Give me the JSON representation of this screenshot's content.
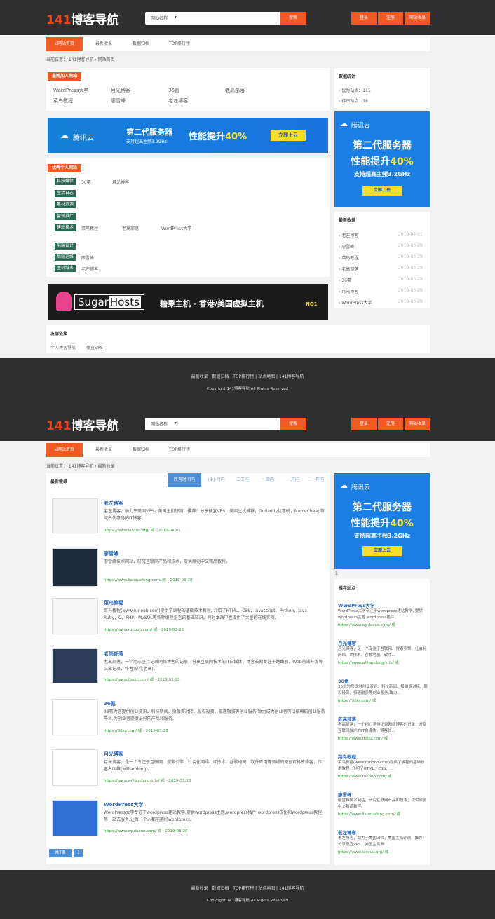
{
  "header": {
    "logo_num": "141",
    "logo_text": "博客导航",
    "search_select": "网站名称",
    "search_btn": "搜索",
    "btn_login": "登录",
    "btn_register": "注册",
    "btn_submit": "网站收录"
  },
  "nav": [
    "网站首页",
    "最新收录",
    "数据归档",
    "TOP排行榜"
  ],
  "page1": {
    "crumb": "当前位置： 141博客导航  ›  网站首页",
    "latest": {
      "title": "最新加入网站",
      "links": [
        "WordPress大学",
        "月光博客",
        "36氪",
        "老高部落",
        "菜鸟教程",
        "廖雪峰",
        "老左博客"
      ]
    },
    "stats": {
      "title": "数据统计",
      "lines": [
        "› 优秀站点：115",
        "› 待审站点：18"
      ]
    },
    "ad_banner": {
      "brand": "腾讯云",
      "l1": "第二代服务器",
      "l2": "支持超高主频3.2GHz",
      "l3": "性能提升",
      "pct": "40%",
      "btn": "立即上云"
    },
    "personal": {
      "title": "优秀个人网站",
      "rows": [
        {
          "tag": "科技媒体",
          "links": [
            "36氪",
            "月光博客"
          ]
        },
        {
          "tag": "生活日志",
          "links": []
        },
        {
          "tag": "素材资源",
          "links": []
        },
        {
          "tag": "营销推广",
          "links": []
        },
        {
          "tag": "建站技术",
          "links": [
            "菜鸟教程",
            "老高部落",
            "WordPress大学"
          ]
        },
        {
          "tag": "前端设计",
          "links": []
        },
        {
          "tag": "后端运维",
          "links": [
            "廖雪峰"
          ]
        },
        {
          "tag": "主机域名",
          "links": [
            "老左博客"
          ]
        }
      ]
    },
    "side_ad": {
      "brand": "腾讯云",
      "l1": "第二代服务器",
      "l2": "性能提升",
      "pct": "40%",
      "l3": "支持超高主频3.2GHz",
      "btn": "立即上云"
    },
    "recent": {
      "title": "最新收录",
      "items": [
        {
          "name": "› 老左博客",
          "date": "2019-04-01"
        },
        {
          "name": "› 廖雪峰",
          "date": "2019-03-28"
        },
        {
          "name": "› 菜鸟教程",
          "date": "2019-03-28"
        },
        {
          "name": "› 老高部落",
          "date": "2019-03-28"
        },
        {
          "name": "› 36氪",
          "date": "2019-03-28"
        },
        {
          "name": "› 月光博客",
          "date": "2019-03-28"
        },
        {
          "name": "› WordPress大学",
          "date": "2019-03-28"
        }
      ]
    },
    "sugar": {
      "brand_a": "Sugar",
      "brand_b": "Hosts",
      "text": "糖果主机 · 香港/美国虚拟主机",
      "tag": "NO1"
    },
    "friends": {
      "title": "友情链接",
      "links": [
        "个人博客导航",
        "便宜VPS"
      ]
    }
  },
  "footer": {
    "links": "最新收录   |   数据归档   |   TOP排行榜   |   站点地图   |   141博客导航",
    "copyright": "Copyright 141博客导航 All Rights Reserved"
  },
  "page2": {
    "crumb": "当前位置： 141博客导航  ›  最新收录",
    "list_title": "最新收录",
    "tabs": [
      "所有时间内",
      "24小时内",
      "三天内",
      "一周内",
      "一月内",
      "一年内"
    ],
    "items": [
      {
        "title": "老左博客",
        "desc": "老左博客，助力于美国VPS，美国主机评测、推荐！分享便宜VPS，美国主机推荐，Godaddy优惠码，NameCheap等域名优惠码的IT博客。",
        "url": "https://www.laozuo.org/ 或 - 2019-04-01"
      },
      {
        "title": "廖雪峰",
        "desc": "廖雪峰技术网站，研究互联网产品和技术，提供原创中文精品教程。",
        "url": "https://www.liaoxuefeng.com/ 或 - 2019-03-28"
      },
      {
        "title": "菜鸟教程",
        "desc": "菜鸟教程(www.runoob.com)提供了编程的基础技术教程, 介绍了HTML、CSS、Javascript、Python，Java，Ruby，C，PHP，MySQL等各种编程语言的基础知识。同时本站中也提供了大量的在线实例。",
        "url": "https://www.runoob.com/ 或 - 2019-03-28"
      },
      {
        "title": "老高部落",
        "desc": "老高部落，一个用心坚持记录网络博客的记录，分享互联网技术的IT自媒体，博客长期专注于路由器、Web前端开发等文章记录，作者名叫(老高)。",
        "url": "https://www.tbulu.com/ 或 - 2019-03-28"
      },
      {
        "title": "36氪",
        "desc": "36氪为您提供创业资讯、科技新闻、投融资对接、股权投资、极速融资等创业服务,致力成为创业者可以依赖的创业服务平台,为创业者提供最好的产品和服务。",
        "url": "https://36kr.com/ 或 - 2019-03-28"
      },
      {
        "title": "月光博客",
        "desc": "月光博客，是一个专注于互联网、搜索引擎、社会化网络、IT技术、谷歌地图、软件应用等领域的原创IT科技博客，作者名叫雄(williamlong)。",
        "url": "https://www.williamlong.info/ 或 - 2019-03-28"
      },
      {
        "title": "WordPress大学",
        "desc": "WordPress大学专注于wordpress建站教学,提供wordpress主题,wordpress插件,wordpress汉化和wordpress教程等一站式服务,让每一个人都能用好wordpress。",
        "url": "https://www.wpdaxue.com/ 或 - 2019-03-28"
      }
    ],
    "pager": [
      "共7条",
      "1"
    ],
    "side_ad": {
      "brand": "腾讯云",
      "l1": "第二代服务器",
      "l2": "性能提升",
      "pct": "40%",
      "l3": "支持超高主频3.2GHz",
      "btn": "立即上云"
    },
    "side_num": "1",
    "recommend": {
      "title": "推荐站点",
      "items": [
        {
          "title": "WordPress大学",
          "desc": "WordPress大学专注于wordpress建站教学, 提供wordpress主题,wordpress插件...",
          "url": "https://www.wpdaxue.com/ 或"
        },
        {
          "title": "月光博客",
          "desc": "月光博客，是一个专注于互联网、搜索引擎、社会化网络、IT技术、谷歌地图、软件...",
          "url": "https://www.williamlong.info/ 或"
        },
        {
          "title": "36氪",
          "desc": "36氪为您提供创业资讯、科技新闻、投融资对接、股权投资、极速融资等创业服务,致力...",
          "url": "https://36kr.com/ 或"
        },
        {
          "title": "老高部落",
          "desc": "老高部落，一个用心坚持记录网络博客的记录，分享互联网技术的IT自媒体，博客长...",
          "url": "https://www.tbulu.com/ 或"
        },
        {
          "title": "菜鸟教程",
          "desc": "菜鸟教程(www.runoob.com)提供了编程的基础技术教程, 介绍了HTML、CSS、...",
          "url": "https://www.runoob.com/ 或"
        },
        {
          "title": "廖雪峰",
          "desc": "廖雪峰技术网站，研究互联网产品和技术，提供原创中文精品教程。",
          "url": "https://www.liaoxuefeng.com/ 或"
        },
        {
          "title": "老左博客",
          "desc": "老左博客，助力于美国VPS，美国主机评测、推荐！分享便宜VPS，美国主机推...",
          "url": "https://www.laozuo.org/ 或"
        }
      ]
    }
  }
}
